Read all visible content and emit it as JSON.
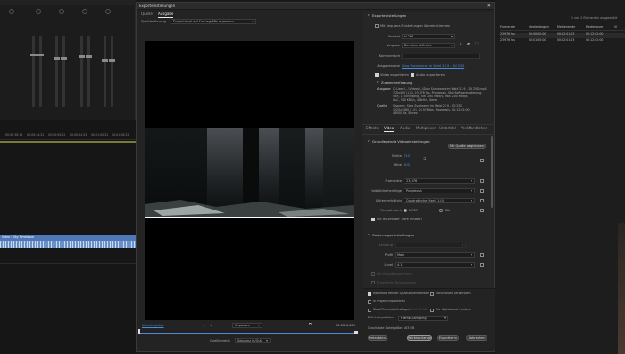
{
  "background": {
    "timeline": {
      "timecodes": [
        "00:00:38:15",
        "00:00:44:22",
        "00:00:50:12",
        "00:00:54:22",
        "00:01:00:22",
        "00:01:06:22",
        "00:01:10:21"
      ],
      "clip_label": "Video 1 Sky Timelapse"
    },
    "project_panel": {
      "item_count": "1 von 2 Elementen ausgewählt",
      "columns": [
        "Framerate",
        "Medienbeginn",
        "Medienende",
        "Medienauer",
        "Vi"
      ],
      "rows": [
        {
          "framerate": "23,976 fps",
          "start": "00:00:00:00",
          "end": "00:12:01:23",
          "duration": "00:12:02:00"
        },
        {
          "framerate": "23,976 fps",
          "start": "00:01:00:00",
          "end": "00:12:01:23",
          "duration": "00:12:02:00"
        }
      ]
    }
  },
  "dialog": {
    "title": "Exporteinstellungen",
    "tabs": [
      "Quelle",
      "Ausgabe"
    ],
    "active_tab": "Ausgabe",
    "source_scaling_label": "Quellskalierung",
    "source_scaling_value": "Proportional auf Framegröße anpassen",
    "source_range_label": "Quellbereich",
    "source_range_link": "Aktuell global",
    "source_range_value": "Anpassen",
    "timecode": "00:12:4:100",
    "range_label": "Quellbereich",
    "range_value": "Sequenz In/Out",
    "export_settings": {
      "heading": "Exporteinstellungen",
      "match_sequence_label": "Mit Sequenz-Einstellungen übereinstimmen",
      "format_label": "Format",
      "format_value": "H.264",
      "preset_label": "Vorgabe",
      "preset_value": "Benutzerdefiniert",
      "comments_label": "Kommentare",
      "output_name_label": "Ausgabename",
      "output_name_value": "Slow Sunbeams im Wald 23.9 - DJI 25D",
      "export_video_label": "Video exportieren",
      "export_audio_label": "Audio exportieren",
      "summary_heading": "Zusammenfassung",
      "output_label": "Ausgabe",
      "output_lines": [
        "C:\\Users\\...\\Videos\\...\\Slow Sunbeams im Wald 23.9 - DJI 25D.mp4",
        "720x400 (1,0), 23,976 fps, Progressiv, Std. Softwarecodierung",
        "VBR, 1 Durchgang, Ziel 2,00 MBit/s, Max 2,00 MBit/s",
        "AAC, 320 KBit/s, 48 kHz, Stereo"
      ],
      "source_label": "Quelle",
      "source_lines": [
        "Sequenz, Slow Sunbeams im Wald 23.9 - DJI 25D",
        "1920x1080 (1,0), 23,976 fps, Progressiv, 00:12:02:00",
        "48000 Hz, Stereo"
      ]
    },
    "settings_tabs": [
      "Effekte",
      "Video",
      "Audio",
      "Multiplexer",
      "Untertitel",
      "Veröffentlichen"
    ],
    "active_settings_tab": "Video",
    "basic_video": {
      "heading": "Grundlegende Videoeinstellungen",
      "match_source_button": "Mit Quelle abgleichen",
      "width_label": "Breite",
      "width_value": "720",
      "height_label": "Höhe",
      "height_value": "400",
      "framerate_label": "Framerate",
      "framerate_value": "23,976",
      "field_order_label": "Halbbildreihenfolge",
      "field_order_value": "Progressiv",
      "aspect_label": "Seitenverhältnis",
      "aspect_value": "Quadratische Pixel (1,0)",
      "tv_standard_label": "Fernsehnorm",
      "tv_ntsc": "NTSC",
      "tv_pal": "PAL",
      "max_depth_label": "Mit maximaler Tiefe rendern"
    },
    "encoding": {
      "heading": "Codierungseinstellungen",
      "performance_label": "Leistung",
      "profile_label": "Profil",
      "profile_value": "Main",
      "level_label": "Level",
      "level_value": "4.1",
      "hint_1": "Als Vorgabe speichern",
      "hint_2": "Erweiterte Einstellungen"
    },
    "bottom": {
      "max_quality_label": "Maximale Render-Qualität verwenden",
      "previews_label": "Vorschauen verwenden",
      "import_project_label": "In Projekt importieren",
      "start_timecode_label": "Start-Timecode festlegen",
      "start_timecode_value": "00:00:00:00",
      "alpha_label": "Nur Alphakanal rendern",
      "interpolation_label": "Zeit-Interpolation",
      "interpolation_value": "Frame-Sampling",
      "filesize_label": "Geschätzte Dateigröße:",
      "filesize_value": "183 MB"
    },
    "buttons": {
      "metadata": "Metadaten...",
      "queue": "Warteschlange",
      "export": "Exportieren",
      "cancel": "Abbrechen"
    }
  },
  "colors": {
    "accent": "#4a8ad8",
    "timeline_clip": "#4f78b8",
    "marker": "#2a7ad0"
  }
}
